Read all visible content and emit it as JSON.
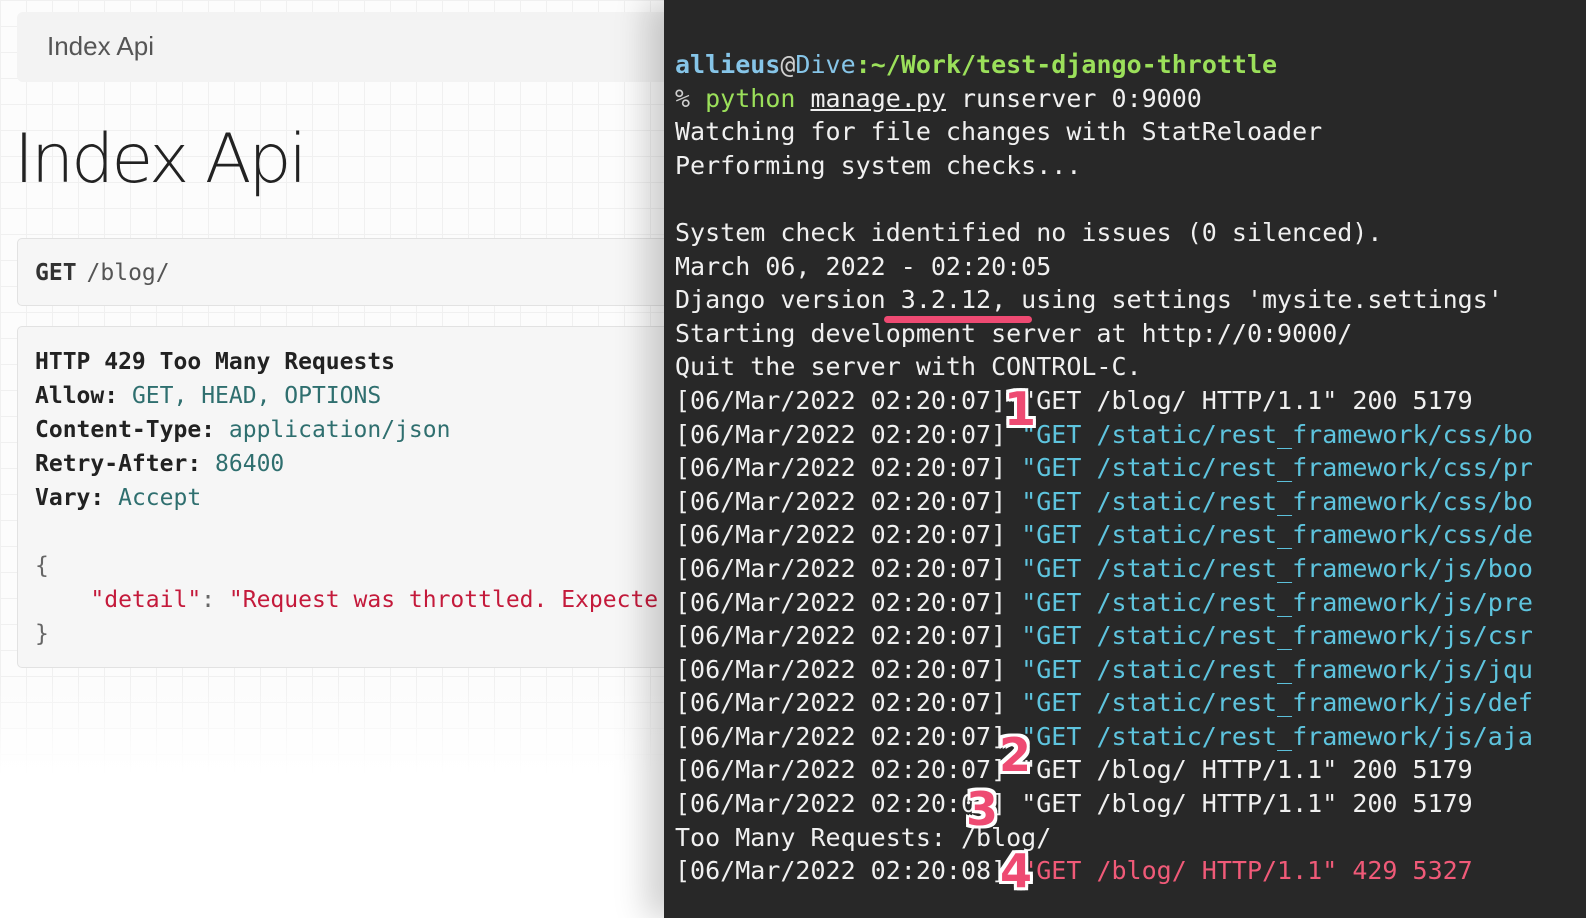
{
  "browser": {
    "breadcrumb": "Index Api",
    "title": "Index Api",
    "request": {
      "method": "GET",
      "path": "/blog/"
    },
    "response": {
      "status": "HTTP 429 Too Many Requests",
      "headers": [
        {
          "name": "Allow:",
          "value": "GET, HEAD, OPTIONS"
        },
        {
          "name": "Content-Type:",
          "value": "application/json"
        },
        {
          "name": "Retry-After:",
          "value": "86400"
        },
        {
          "name": "Vary:",
          "value": "Accept"
        }
      ],
      "body_open": "{",
      "body_key": "\"detail\"",
      "body_sep": ": ",
      "body_value": "\"Request was throttled. Expecte",
      "body_close": "}"
    }
  },
  "terminal": {
    "prompt_user": "allieus",
    "prompt_at": "@",
    "prompt_host": "Dive",
    "prompt_path": ":~/Work/test-django-throttle",
    "prompt_symbol": "% ",
    "cmd_python": "python",
    "cmd_file": "manage.py",
    "cmd_args": " runserver 0:9000",
    "out1": "Watching for file changes with StatReloader",
    "out2": "Performing system checks...",
    "out3": "System check identified no issues (0 silenced).",
    "out4": "March 06, 2022 - 02:20:05",
    "out5": "Django version 3.2.12, using settings 'mysite.settings'",
    "out6": "Starting development server at http://0:9000/",
    "out7": "Quit the server with CONTROL-C.",
    "log": [
      {
        "ts": "[06/Mar/2022 02:20:07] ",
        "req": "\"GET /blog/ HTTP/1.1\" 200 5179",
        "kind": "plain"
      },
      {
        "ts": "[06/Mar/2022 02:20:07] ",
        "req": "\"GET /static/rest_framework/css/bo",
        "kind": "static"
      },
      {
        "ts": "[06/Mar/2022 02:20:07] ",
        "req": "\"GET /static/rest_framework/css/pr",
        "kind": "static"
      },
      {
        "ts": "[06/Mar/2022 02:20:07] ",
        "req": "\"GET /static/rest_framework/css/bo",
        "kind": "static"
      },
      {
        "ts": "[06/Mar/2022 02:20:07] ",
        "req": "\"GET /static/rest_framework/css/de",
        "kind": "static"
      },
      {
        "ts": "[06/Mar/2022 02:20:07] ",
        "req": "\"GET /static/rest_framework/js/boo",
        "kind": "static"
      },
      {
        "ts": "[06/Mar/2022 02:20:07] ",
        "req": "\"GET /static/rest_framework/js/pre",
        "kind": "static"
      },
      {
        "ts": "[06/Mar/2022 02:20:07] ",
        "req": "\"GET /static/rest_framework/js/csr",
        "kind": "static"
      },
      {
        "ts": "[06/Mar/2022 02:20:07] ",
        "req": "\"GET /static/rest_framework/js/jqu",
        "kind": "static"
      },
      {
        "ts": "[06/Mar/2022 02:20:07] ",
        "req": "\"GET /static/rest_framework/js/def",
        "kind": "static"
      },
      {
        "ts": "[06/Mar/2022 02:20:07] ",
        "req": "\"GET /static/rest_framework/js/aja",
        "kind": "static"
      },
      {
        "ts": "[06/Mar/2022 02:20:07] ",
        "req": "\"GET /blog/ HTTP/1.1\" 200 5179",
        "kind": "plain"
      },
      {
        "ts": "[06/Mar/2022 02:20:08] ",
        "req": "\"GET /blog/ HTTP/1.1\" 200 5179",
        "kind": "plain"
      }
    ],
    "throttle_msg": "Too Many Requests: /blog/",
    "last_ts": "[06/Mar/2022 02:20:08] ",
    "last_req": "\"GET /blog/ HTTP/1.1\" 429 5327"
  },
  "annotations": {
    "colors": {
      "marker": "#ee4a72",
      "outline": "#ffffff"
    },
    "markers": [
      "1",
      "2",
      "3",
      "4"
    ]
  }
}
